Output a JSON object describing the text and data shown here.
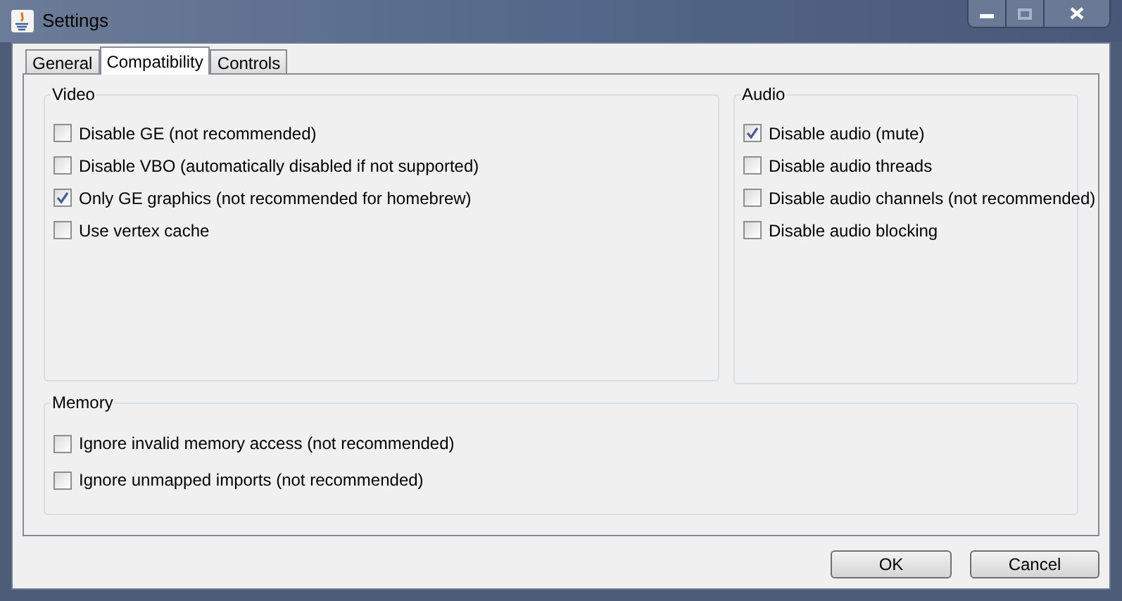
{
  "window": {
    "title": "Settings"
  },
  "tabs": [
    {
      "label": "General",
      "selected": false
    },
    {
      "label": "Compatibility",
      "selected": true
    },
    {
      "label": "Controls",
      "selected": false
    }
  ],
  "video": {
    "title": "Video",
    "options": [
      {
        "label": "Disable GE (not recommended)",
        "checked": false
      },
      {
        "label": "Disable VBO (automatically disabled if not supported)",
        "checked": false
      },
      {
        "label": "Only GE graphics (not recommended for homebrew)",
        "checked": true
      },
      {
        "label": "Use vertex cache",
        "checked": false
      }
    ]
  },
  "audio": {
    "title": "Audio",
    "options": [
      {
        "label": "Disable audio (mute)",
        "checked": true
      },
      {
        "label": "Disable audio threads",
        "checked": false
      },
      {
        "label": "Disable audio channels (not recommended)",
        "checked": false
      },
      {
        "label": "Disable audio blocking",
        "checked": false
      }
    ]
  },
  "memory": {
    "title": "Memory",
    "options": [
      {
        "label": "Ignore invalid memory access (not recommended)",
        "checked": false
      },
      {
        "label": "Ignore unmapped imports (not recommended)",
        "checked": false
      }
    ]
  },
  "buttons": [
    "OK",
    "Cancel"
  ]
}
